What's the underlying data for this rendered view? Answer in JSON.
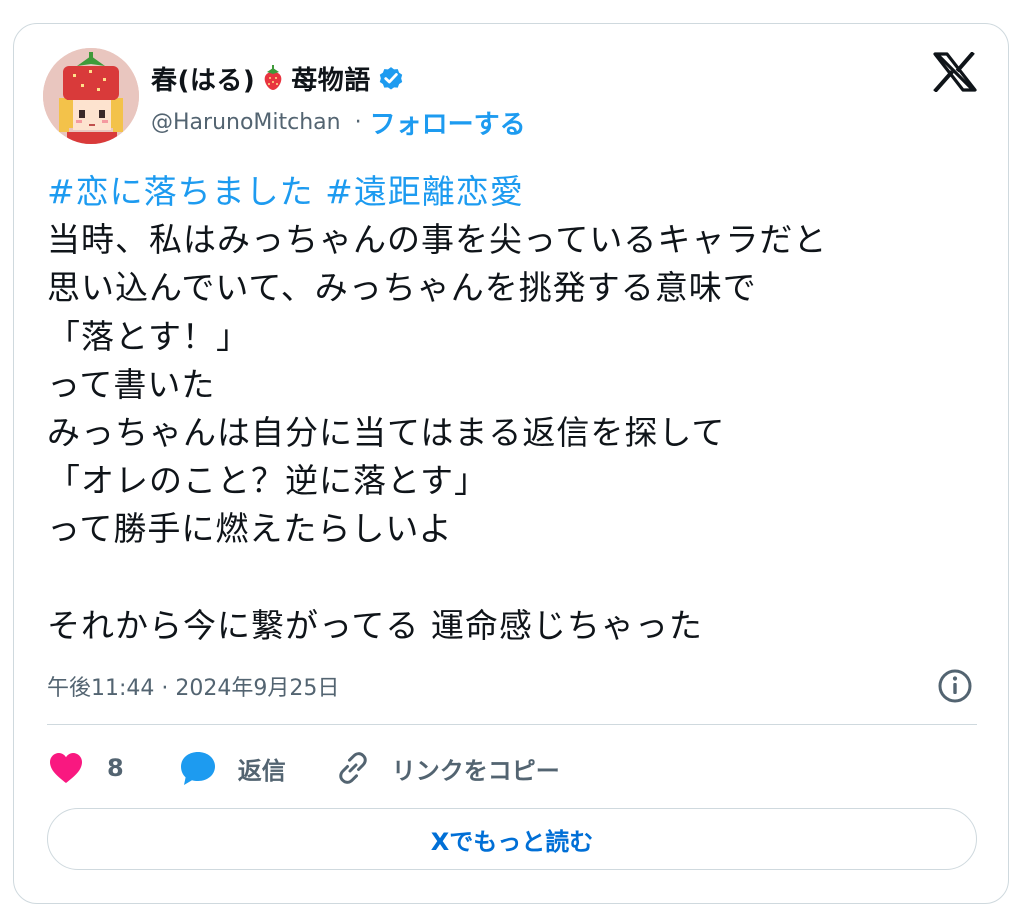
{
  "author": {
    "name": "春(はる)",
    "name_suffix": "苺物語",
    "handle": "@HarunoMitchan",
    "separator": "·",
    "follow_label": "フォローする"
  },
  "tweet": {
    "hashtags": [
      "#恋に落ちました",
      "#遠距離恋愛"
    ],
    "body": "当時、私はみっちゃんの事を尖っているキャラだと\n思い込んでいて、みっちゃんを挑発する意味で\n「落とす！」\nって書いた\nみっちゃんは自分に当てはまる返信を探して\n「オレのこと？逆に落とす」\nって勝手に燃えたらしいよ\n\nそれから今に繋がってる 運命感じちゃった",
    "timestamp": "午後11:44 · 2024年9月25日"
  },
  "actions": {
    "like_count": "8",
    "reply_label": "返信",
    "copy_link_label": "リンクをコピー"
  },
  "read_more_label": "Xでもっと読む",
  "colors": {
    "accent": "#1d9bf0",
    "like": "#f91880",
    "muted": "#536471",
    "border": "#cfd9de"
  },
  "icons": [
    "avatar-strawberry-girl",
    "strawberry-icon",
    "verified-badge-icon",
    "x-logo-icon",
    "info-icon",
    "heart-icon",
    "reply-bubble-icon",
    "link-icon"
  ]
}
